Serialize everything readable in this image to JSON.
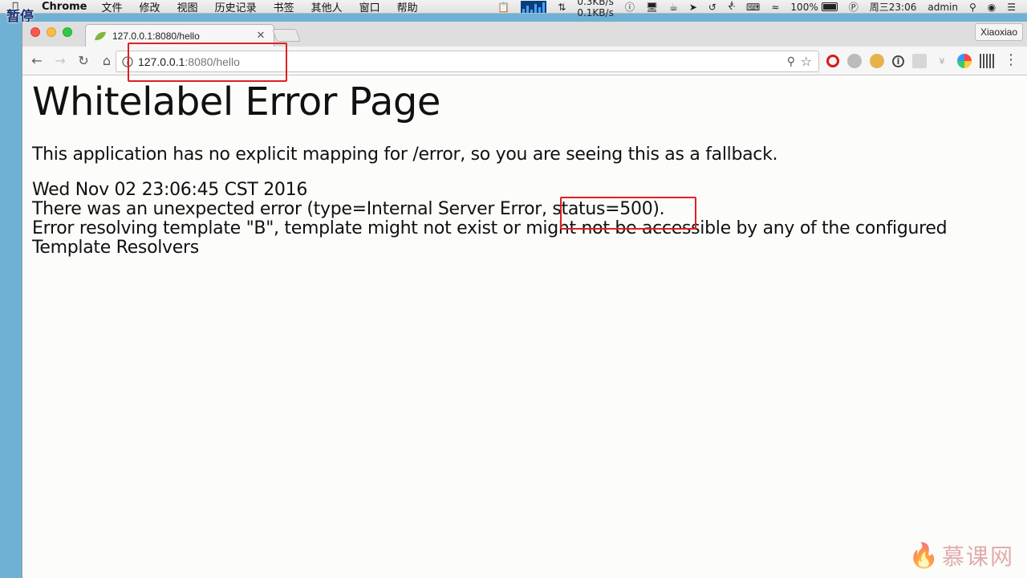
{
  "menubar": {
    "app_name": "Chrome",
    "menus": [
      "文件",
      "修改",
      "视图",
      "历史记录",
      "书签",
      "其他人",
      "窗口",
      "帮助"
    ],
    "net_up": "0.3KB/s",
    "net_down": "0.1KB/s",
    "battery": "100%",
    "clock": "周三23:06",
    "user": "admin"
  },
  "overlay": {
    "pause_label": "暂停"
  },
  "browser": {
    "tab_title": "127.0.0.1:8080/hello",
    "profile_name": "Xiaoxiao",
    "url_host": "127.0.0.1",
    "url_rest": ":8080/hello"
  },
  "page": {
    "heading": "Whitelabel Error Page",
    "lead": "This application has no explicit mapping for /error, so you are seeing this as a fallback.",
    "timestamp": "Wed Nov 02 23:06:45 CST 2016",
    "error_line": "There was an unexpected error (type=Internal Server Error, status=500).",
    "error_detail": "Error resolving template \"B\", template might not exist or might not be accessible by any of the configured Template Resolvers"
  },
  "watermark": {
    "text": "慕课网"
  },
  "colors": {
    "highlight": "#e02020",
    "page_bg": "#fcfcfb",
    "desktop": "#6fb1d4"
  }
}
